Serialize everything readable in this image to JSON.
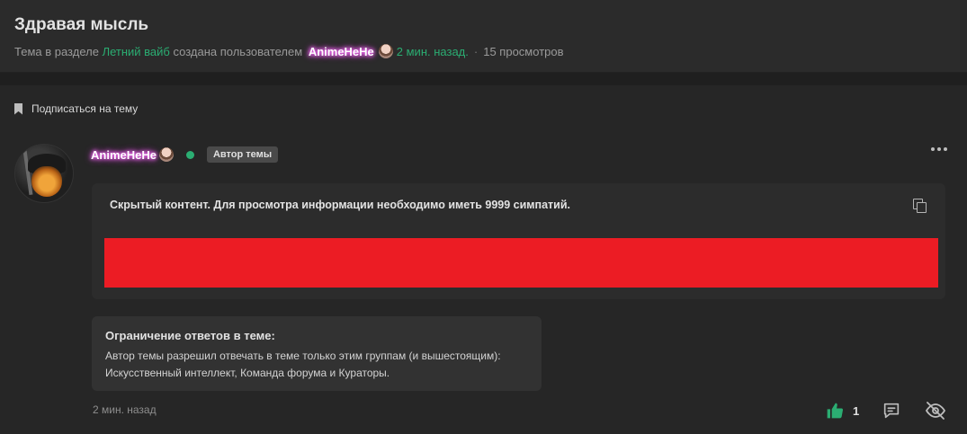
{
  "thread": {
    "title": "Здравая мысль",
    "meta_prefix": "Тема в разделе",
    "section": "Летний вайб",
    "meta_created_by": "создана пользователем",
    "author": "AnimeHeHe",
    "time": "2 мин. назад.",
    "views": "15 просмотров"
  },
  "subscribe": {
    "label": "Подписаться на тему"
  },
  "post": {
    "author": "AnimeHeHe",
    "badge": "Автор темы",
    "hidden_content_text": "Скрытый контент. Для просмотра информации необходимо иметь 9999 симпатий.",
    "restriction_title": "Ограничение ответов в теме:",
    "restriction_text": "Автор темы разрешил отвечать в теме только этим группам (и вышестоящим): Искусственный интеллект, Команда форума и Кураторы.",
    "time": "2 мин. назад",
    "likes": "1"
  },
  "colors": {
    "accent_green": "#2bad72",
    "hidden_bar": "#ec1c24",
    "username_glow": "#ff6cff"
  },
  "icons": {
    "bookmark": "bookmark-icon",
    "more": "more-icon",
    "copy": "copy-icon",
    "like": "thumbs-up-icon",
    "reply": "comment-icon",
    "hide": "eye-off-icon"
  }
}
